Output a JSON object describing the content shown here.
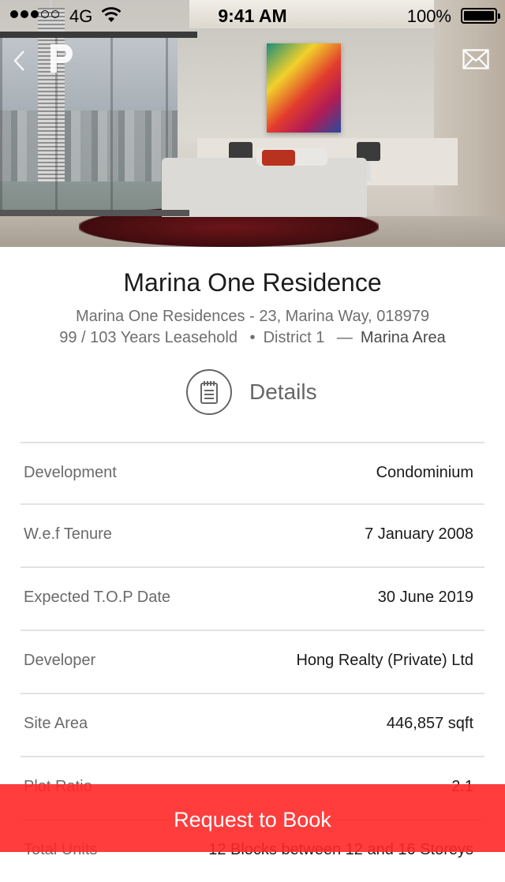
{
  "status_bar": {
    "signal_filled": 3,
    "signal_total": 5,
    "carrier": "4G",
    "time": "9:41 AM",
    "battery": "100%"
  },
  "property": {
    "title": "Marina One Residence",
    "address": "Marina One Residences - 23, Marina Way, 018979",
    "tenure": "99 / 103 Years Leasehold",
    "separator": "•",
    "district": "District 1",
    "dash": "—",
    "area": "Marina Area"
  },
  "details": {
    "header": "Details",
    "rows": [
      {
        "label": "Development",
        "value": "Condominium"
      },
      {
        "label": "W.e.f Tenure",
        "value": "7 January 2008"
      },
      {
        "label": "Expected T.O.P Date",
        "value": "30 June 2019"
      },
      {
        "label": "Developer",
        "value": "Hong Realty (Private) Ltd"
      },
      {
        "label": "Site Area",
        "value": "446,857 sqft"
      },
      {
        "label": "Plot Ratio",
        "value": "2.1"
      },
      {
        "label": "Total Units",
        "value": "12 Blocks between 12 and 16 Storeys"
      }
    ]
  },
  "actions": {
    "book": "Request to Book"
  },
  "icons": {
    "back": "back-chevron-icon",
    "mail": "mail-icon",
    "details": "notepad-icon"
  },
  "colors": {
    "accent": "#ff2828"
  }
}
